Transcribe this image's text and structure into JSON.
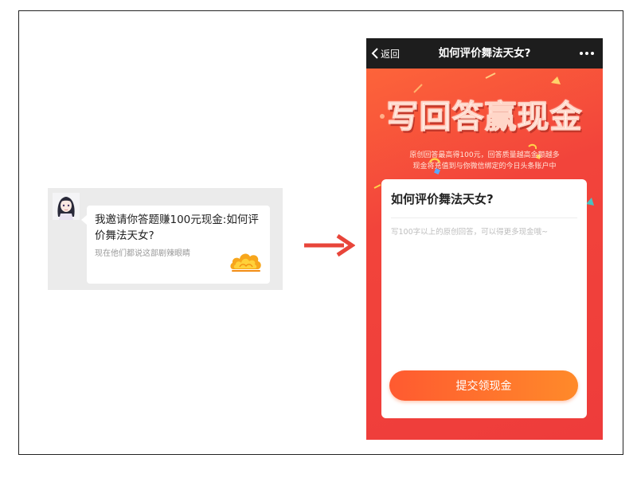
{
  "chat": {
    "title": "我邀请你答题赚100元现金:如何评价舞法天女?",
    "subtitle": "现在他们都说这部剧辣眼睛"
  },
  "phone": {
    "nav": {
      "back_label": "返回",
      "title": "如何评价舞法天女?"
    },
    "banner": {
      "title": "写回答赢现金",
      "desc_line1": "原创回答最高得100元，回答质量越高金额越多",
      "desc_line2": "现金将充值到与你微信绑定的今日头条账户中"
    },
    "card": {
      "question": "如何评价舞法天女?",
      "answer_placeholder": "写100字以上的原创回答，可以得更多现金哦~",
      "submit_label": "提交领现金"
    }
  },
  "colors": {
    "accent": "#f2443b",
    "button_start": "#ff5a30",
    "button_end": "#ff8a2a",
    "navbar": "#1d1d1d"
  },
  "icons": {
    "avatar": "avatar-image",
    "cloud": "auspicious-cloud-icon",
    "arrow": "right-arrow-icon",
    "back": "chevron-left-icon",
    "more": "more-dots-icon"
  }
}
